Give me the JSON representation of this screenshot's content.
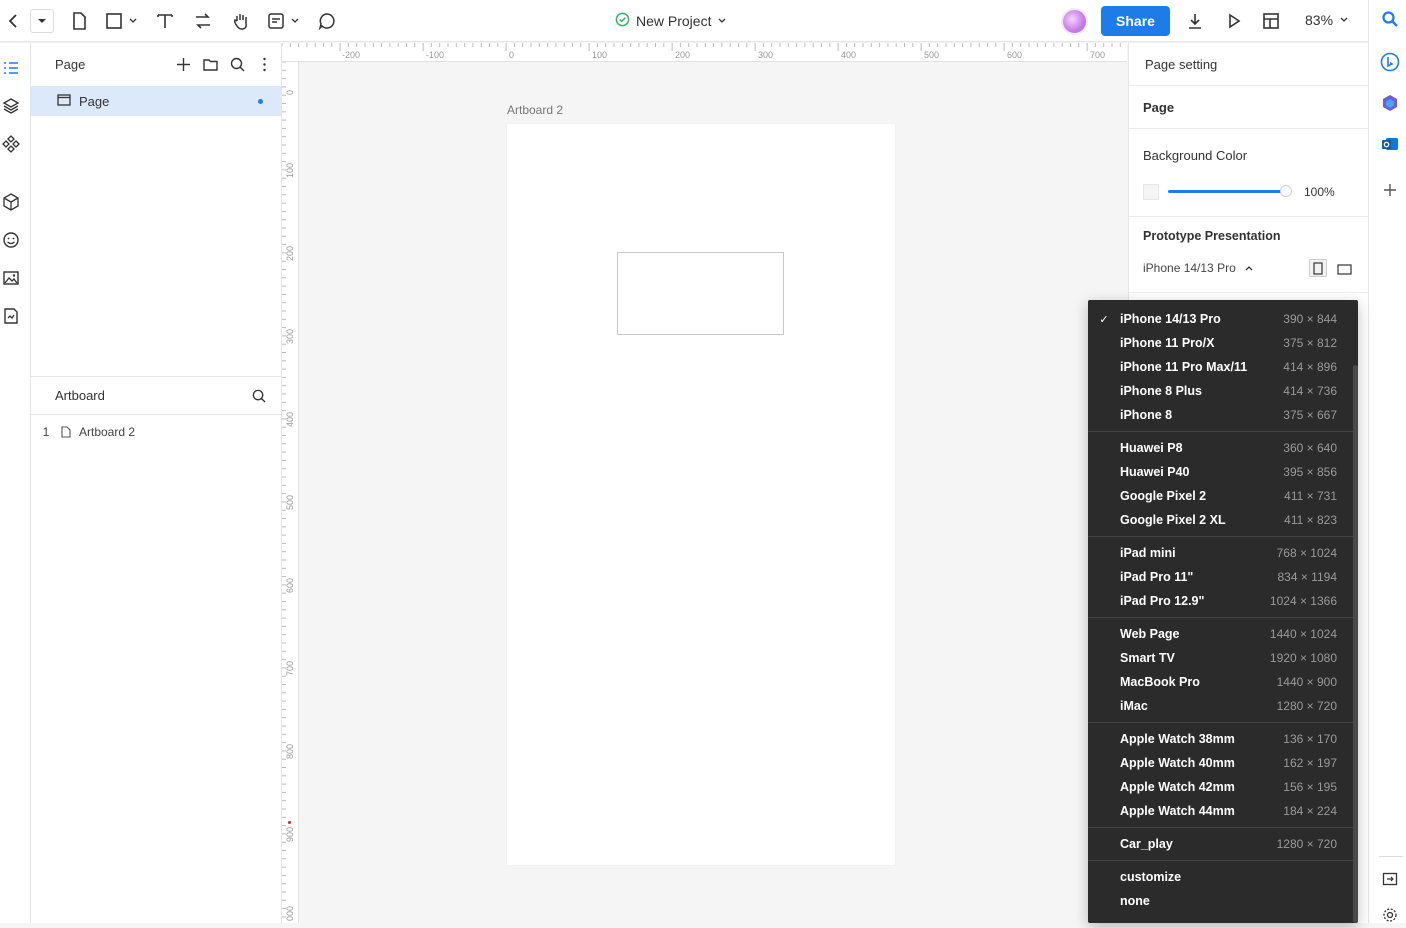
{
  "topbar": {
    "project_title": "New Project",
    "share_label": "Share",
    "zoom_label": "83%"
  },
  "left_panel": {
    "page_header": "Page",
    "page_item": "Page",
    "artboard_header": "Artboard",
    "artboards": [
      {
        "index": "1",
        "name": "Artboard 2"
      }
    ]
  },
  "rulers": {
    "top_ticks": [
      "-200",
      "-100",
      "0",
      "100",
      "200",
      "300",
      "400",
      "500",
      "600",
      "700"
    ],
    "left_ticks": [
      "0",
      "100",
      "200",
      "300",
      "400",
      "500",
      "600",
      "700",
      "800",
      "900",
      "000"
    ]
  },
  "canvas": {
    "artboard_label": "Artboard 2"
  },
  "right_panel": {
    "page_setting": "Page setting",
    "page_label": "Page",
    "background_label": "Background Color",
    "background_opacity": "100%",
    "prototype_label": "Prototype Presentation",
    "device_selected": "iPhone 14/13 Pro"
  },
  "dropdown": {
    "groups": [
      [
        {
          "name": "iPhone 14/13 Pro",
          "size": "390 × 844",
          "checked": true
        },
        {
          "name": "iPhone 11 Pro/X",
          "size": "375 × 812"
        },
        {
          "name": "iPhone 11 Pro Max/11",
          "size": "414 × 896"
        },
        {
          "name": "iPhone 8 Plus",
          "size": "414 × 736"
        },
        {
          "name": "iPhone 8",
          "size": "375 × 667"
        }
      ],
      [
        {
          "name": "Huawei P8",
          "size": "360 × 640"
        },
        {
          "name": "Huawei P40",
          "size": "395 × 856"
        },
        {
          "name": "Google Pixel 2",
          "size": "411 × 731"
        },
        {
          "name": "Google Pixel 2 XL",
          "size": "411 × 823"
        }
      ],
      [
        {
          "name": "iPad mini",
          "size": "768 × 1024"
        },
        {
          "name": "iPad Pro 11\"",
          "size": "834 × 1194"
        },
        {
          "name": "iPad Pro 12.9\"",
          "size": "1024 × 1366"
        }
      ],
      [
        {
          "name": "Web Page",
          "size": "1440 × 1024"
        },
        {
          "name": "Smart TV",
          "size": "1920 × 1080"
        },
        {
          "name": "MacBook Pro",
          "size": "1440 × 900"
        },
        {
          "name": "iMac",
          "size": "1280 × 720"
        }
      ],
      [
        {
          "name": "Apple Watch 38mm",
          "size": "136 × 170"
        },
        {
          "name": "Apple Watch 40mm",
          "size": "162 × 197"
        },
        {
          "name": "Apple Watch 42mm",
          "size": "156 × 195"
        },
        {
          "name": "Apple Watch 44mm",
          "size": "184 × 224"
        }
      ],
      [
        {
          "name": "Car_play",
          "size": "1280 × 720"
        }
      ],
      [
        {
          "name": "customize",
          "size": ""
        },
        {
          "name": "none",
          "size": ""
        }
      ]
    ]
  },
  "colors": {
    "accent": "#1e7ce8",
    "dropdown_bg": "#2b2b2b",
    "selected_row": "#dbe9fb",
    "status_ok": "#2fb36b"
  }
}
